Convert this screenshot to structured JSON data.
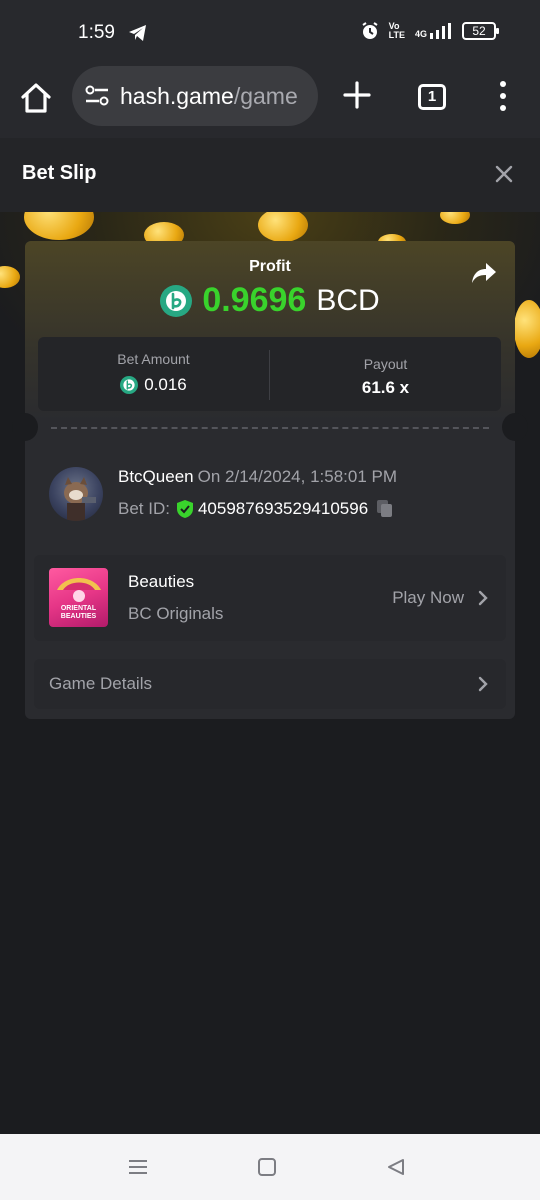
{
  "status_bar": {
    "time": "1:59",
    "network_volte_top": "Vo",
    "network_volte_bottom": "LTE",
    "network_4g": "4G",
    "battery": "52"
  },
  "browser": {
    "url_main": "hash.game",
    "url_rest": "/game",
    "tab_count": "1"
  },
  "slip": {
    "title": "Bet Slip",
    "profit_label": "Profit",
    "profit_value": "0.9696",
    "profit_currency": "BCD",
    "bet_amount_label": "Bet Amount",
    "bet_amount_value": "0.016",
    "payout_label": "Payout",
    "payout_value": "61.6 x",
    "user_name": "BtcQueen",
    "date_text": "On 2/14/2024, 1:58:01 PM",
    "bet_id_label": "Bet ID:",
    "bet_id_value": "405987693529410596",
    "game_title": "Beauties",
    "game_provider": "BC Originals",
    "game_thumb_line1": "ORIENTAL",
    "game_thumb_line2": "BEAUTIES",
    "play_now_label": "Play Now",
    "game_details_label": "Game Details"
  },
  "colors": {
    "profit_green": "#39d32c",
    "coin_teal": "#27a883",
    "background": "#1b1c1f"
  },
  "icons": [
    "telegram-icon",
    "alarm-icon",
    "signal-icon",
    "home-icon",
    "site-settings-icon",
    "plus-icon",
    "tabs-icon",
    "overflow-menu-icon",
    "close-icon",
    "share-icon",
    "bc-coin-icon",
    "verified-shield-icon",
    "copy-icon",
    "chevron-right-icon"
  ]
}
